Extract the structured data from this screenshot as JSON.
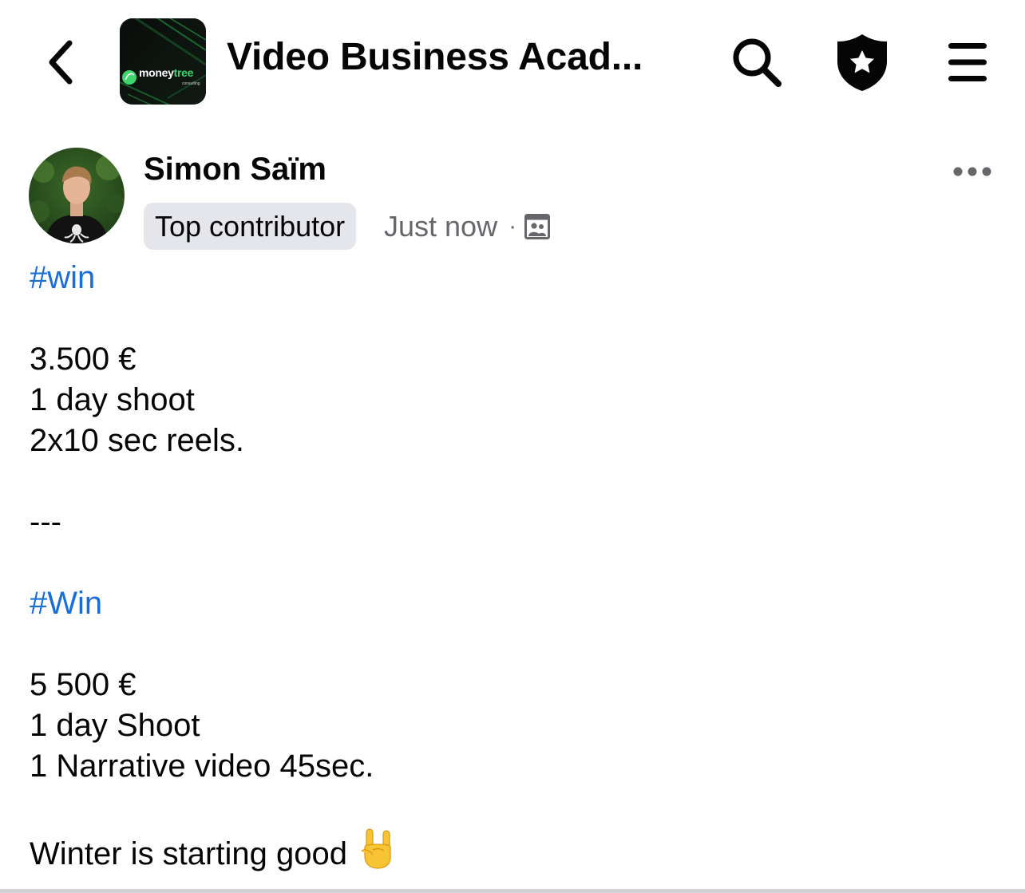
{
  "header": {
    "back_icon": "chevron-left-icon",
    "group_title": "Video Business Acad...",
    "group_logo": {
      "brand_part1": "money",
      "brand_part2": "tree",
      "sub": "consulting"
    },
    "icons": [
      "search-icon",
      "admin-shield-star-icon",
      "menu-icon"
    ]
  },
  "post": {
    "author": "Simon Saïm",
    "badge": "Top contributor",
    "time": "Just now",
    "separator": "·",
    "audience_icon": "group-members-icon",
    "more_icon": "more-horizontal-icon",
    "body": {
      "hashtag1": "#win",
      "line1": "3.500 €",
      "line2": "1 day shoot",
      "line3": "2x10 sec reels.",
      "divider": "---",
      "hashtag2": "#Win",
      "line4": "5 500 €",
      "line5": "1 day Shoot",
      "line6": "1 Narrative video 45sec.",
      "line7": "Winter is starting good",
      "emoji": "rock-on-hand-emoji"
    }
  },
  "colors": {
    "hashtag": "#1a6ed8",
    "meta_text": "#65676b",
    "badge_bg": "#e4e6eb",
    "text": "#050505",
    "logo_accent": "#3fd46b"
  }
}
